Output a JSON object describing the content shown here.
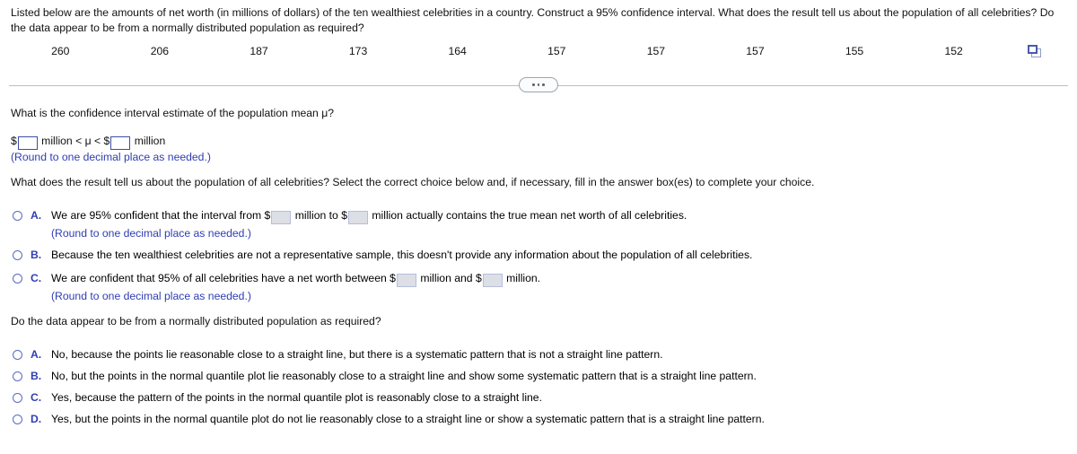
{
  "prompt": {
    "text": "Listed below are the amounts of net worth (in millions of dollars) of the ten wealthiest celebrities in a country. Construct a 95% confidence interval. What does the result tell us about the population of all celebrities? Do the data appear to be from a normally distributed population as required?"
  },
  "data_values": [
    "260",
    "206",
    "187",
    "173",
    "164",
    "157",
    "157",
    "157",
    "155",
    "152"
  ],
  "copy_icon": "copy-to-clipboard-icon",
  "divider": {
    "icon": "ellipsis-icon"
  },
  "q1": {
    "question": "What is the confidence interval estimate of the population mean μ?",
    "dollar_sign": "$",
    "unit": "million",
    "mid_operator": "< μ < $",
    "lower_value": "",
    "upper_value": "",
    "round_note": "(Round to one decimal place as needed.)"
  },
  "q2": {
    "question": "What does the result tell us about the population of all celebrities? Select the correct choice below and, if necessary, fill in the answer box(es) to complete your choice.",
    "options": [
      {
        "letter": "A.",
        "pre": "We are 95% confident that the interval from $",
        "mid": "million to $",
        "post": "million actually contains the true mean net worth of all celebrities.",
        "value1": "",
        "value2": "",
        "sub": "(Round to one decimal place as needed.)",
        "selected": false
      },
      {
        "letter": "B.",
        "pre": "Because the ten wealthiest celebrities are not a representative sample, this doesn't provide any information about the population of all celebrities.",
        "mid": "",
        "post": "",
        "value1": "",
        "value2": "",
        "sub": "",
        "selected": false
      },
      {
        "letter": "C.",
        "pre": "We are confident that 95% of all celebrities have a net worth between $",
        "mid": "million and $",
        "post": "million.",
        "value1": "",
        "value2": "",
        "sub": "(Round to one decimal place as needed.)",
        "selected": false
      }
    ]
  },
  "q3": {
    "question": "Do the data appear to be from a normally distributed population as required?",
    "options": [
      {
        "letter": "A.",
        "text": "No, because the points lie reasonable close to a straight line, but there is a systematic pattern that is not a straight line pattern.",
        "selected": false
      },
      {
        "letter": "B.",
        "text": "No, but the points in the normal quantile plot lie reasonably close to a straight line and show some systematic pattern that is a straight line pattern.",
        "selected": false
      },
      {
        "letter": "C.",
        "text": "Yes, because the pattern of the points in the normal quantile plot is reasonably close to a straight line.",
        "selected": false
      },
      {
        "letter": "D.",
        "text": "Yes, but the points in the normal quantile plot do not lie reasonably close to a straight line or show a systematic pattern that is a straight line pattern.",
        "selected": false
      }
    ]
  },
  "colors": {
    "accent_blue": "#2f3db3",
    "radio_border": "#5a6bbf",
    "input_border": "#3b4ea8",
    "divider": "#b9bfc9"
  }
}
